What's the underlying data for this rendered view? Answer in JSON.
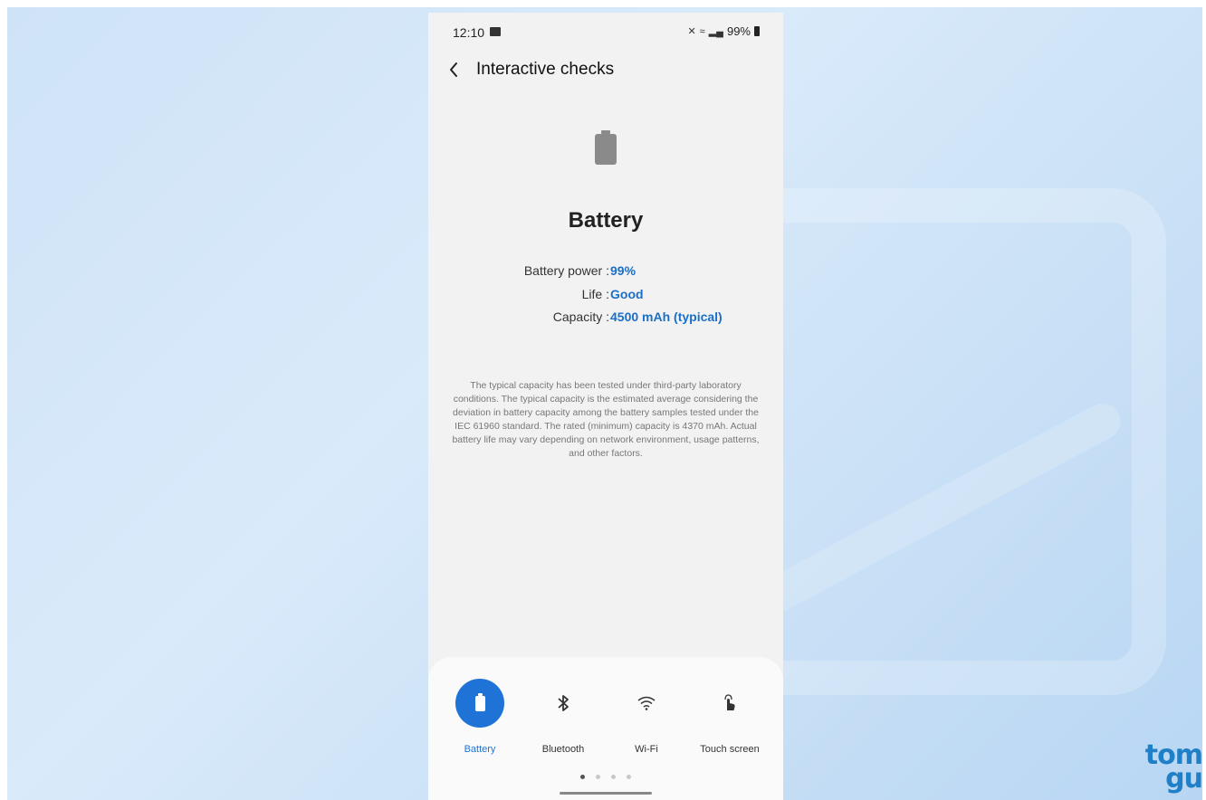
{
  "status_bar": {
    "time": "12:10",
    "battery_percent": "99%"
  },
  "header": {
    "title": "Interactive checks"
  },
  "battery": {
    "title": "Battery",
    "rows": [
      {
        "label": "Battery power : ",
        "value": "99%"
      },
      {
        "label": "Life : ",
        "value": "Good"
      },
      {
        "label": "Capacity : ",
        "value": "4500 mAh (typical)"
      }
    ],
    "disclaimer": "The typical capacity has been tested under third-party laboratory conditions. The typical capacity is the estimated average considering the deviation in battery capacity among the battery samples tested under the IEC 61960 standard. The rated (minimum) capacity is 4370 mAh. Actual battery life may vary depending on network environment, usage patterns, and other factors."
  },
  "tabs": [
    {
      "label": "Battery",
      "icon": "battery-icon",
      "active": true
    },
    {
      "label": "Bluetooth",
      "icon": "bluetooth-icon",
      "active": false
    },
    {
      "label": "Wi-Fi",
      "icon": "wifi-icon",
      "active": false
    },
    {
      "label": "Touch screen",
      "icon": "touch-icon",
      "active": false
    }
  ],
  "colors": {
    "accent": "#1f73d6",
    "value_text": "#1a6fc9",
    "background": "#f2f2f2"
  },
  "brand": {
    "text_line1": "tom",
    "text_line2": "gu"
  }
}
